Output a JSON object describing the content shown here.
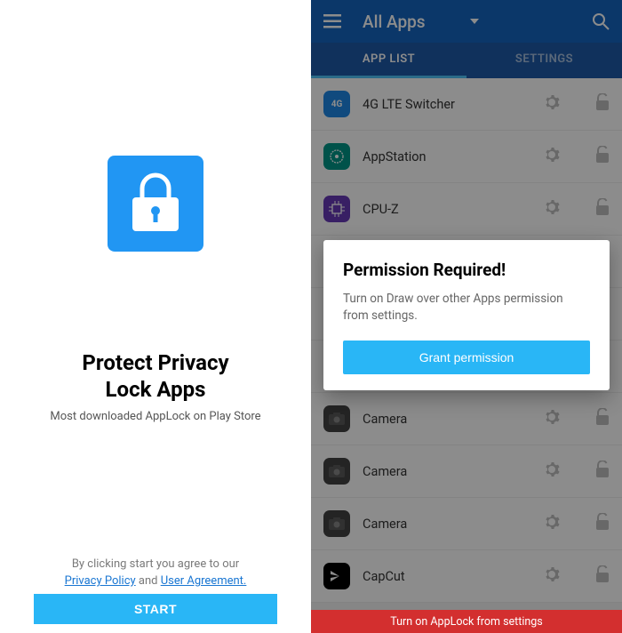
{
  "left": {
    "title_line1": "Protect Privacy",
    "title_line2": "Lock Apps",
    "subtitle": "Most downloaded AppLock on Play Store",
    "agreement_prefix": "By clicking start you agree to our",
    "privacy_link": "Privacy Policy",
    "and": " and ",
    "user_agreement_link": "User Agreement.",
    "start_button": "START"
  },
  "right": {
    "toolbar_title": "All Apps",
    "tabs": {
      "app_list": "APP LIST",
      "settings": "SETTINGS"
    },
    "apps": [
      {
        "name": "4G LTE Switcher",
        "icon_class": "icon-4g",
        "icon_text": "4G"
      },
      {
        "name": "AppStation",
        "icon_class": "icon-appstation",
        "icon_text": ""
      },
      {
        "name": "CPU-Z",
        "icon_class": "icon-cpuz",
        "icon_text": ""
      },
      {
        "name": "",
        "icon_class": "",
        "icon_text": ""
      },
      {
        "name": "",
        "icon_class": "",
        "icon_text": ""
      },
      {
        "name": "",
        "icon_class": "",
        "icon_text": ""
      },
      {
        "name": "Camera",
        "icon_class": "icon-camera",
        "icon_text": ""
      },
      {
        "name": "Camera",
        "icon_class": "icon-camera",
        "icon_text": ""
      },
      {
        "name": "Camera",
        "icon_class": "icon-camera",
        "icon_text": ""
      },
      {
        "name": "CapCut",
        "icon_class": "icon-capcut",
        "icon_text": ""
      }
    ],
    "dialog": {
      "title": "Permission Required!",
      "body": "Turn on Draw over other Apps permission from settings.",
      "button": "Grant permission"
    },
    "bottom_bar": "Turn on AppLock from settings"
  }
}
